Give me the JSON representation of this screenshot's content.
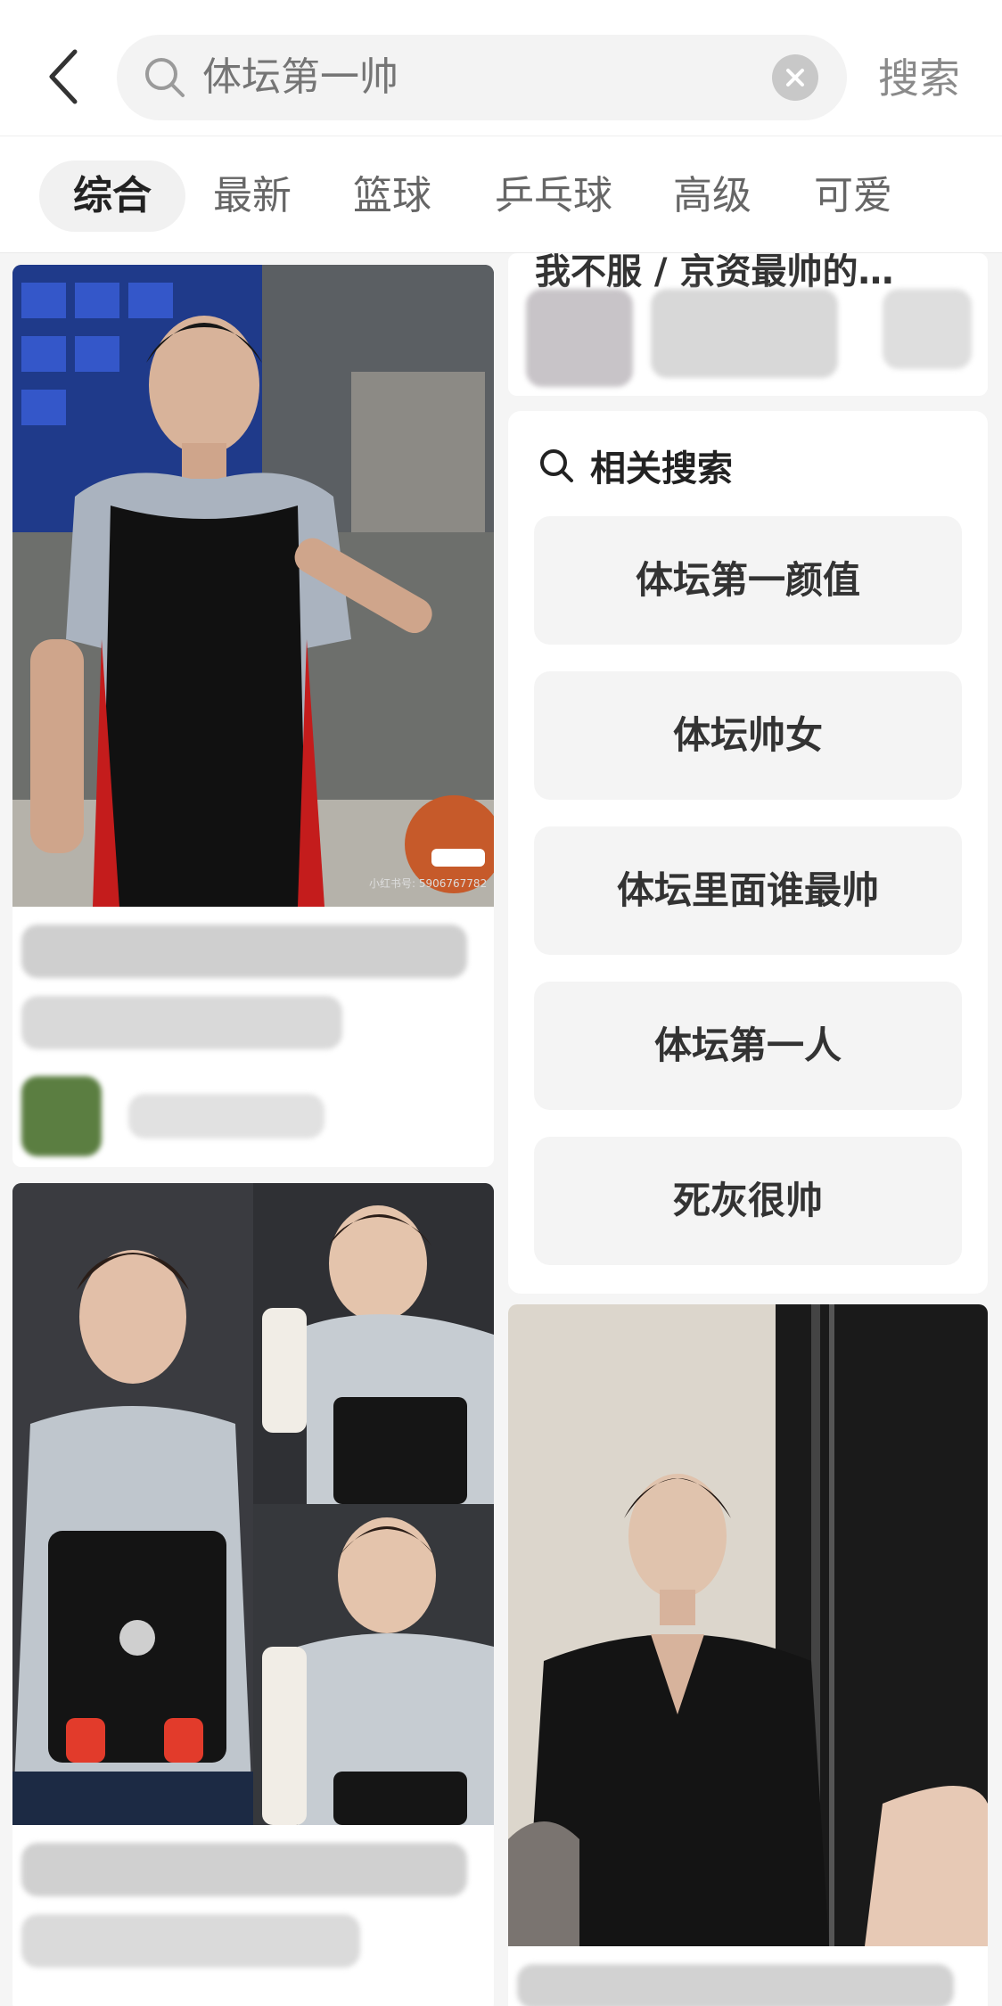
{
  "header": {
    "search_placeholder": "体坛第一帅",
    "search_button": "搜索"
  },
  "tabs": [
    {
      "label": "综合",
      "active": true
    },
    {
      "label": "最新",
      "active": false
    },
    {
      "label": "篮球",
      "active": false
    },
    {
      "label": "乒乓球",
      "active": false
    },
    {
      "label": "高级",
      "active": false
    },
    {
      "label": "可爱",
      "active": false
    }
  ],
  "feed": {
    "top_right_partial_title": "我不服 / 京资最帅的…",
    "watermark_text": "小红书号: 5906767782"
  },
  "related": {
    "title": "相关搜索",
    "items": [
      "体坛第一颜值",
      "体坛帅女",
      "体坛里面谁最帅",
      "体坛第一人",
      "死灰很帅"
    ]
  },
  "colors": {
    "background": "#f5f5f5",
    "accent": "#222222",
    "muted": "#8a8a8a"
  }
}
